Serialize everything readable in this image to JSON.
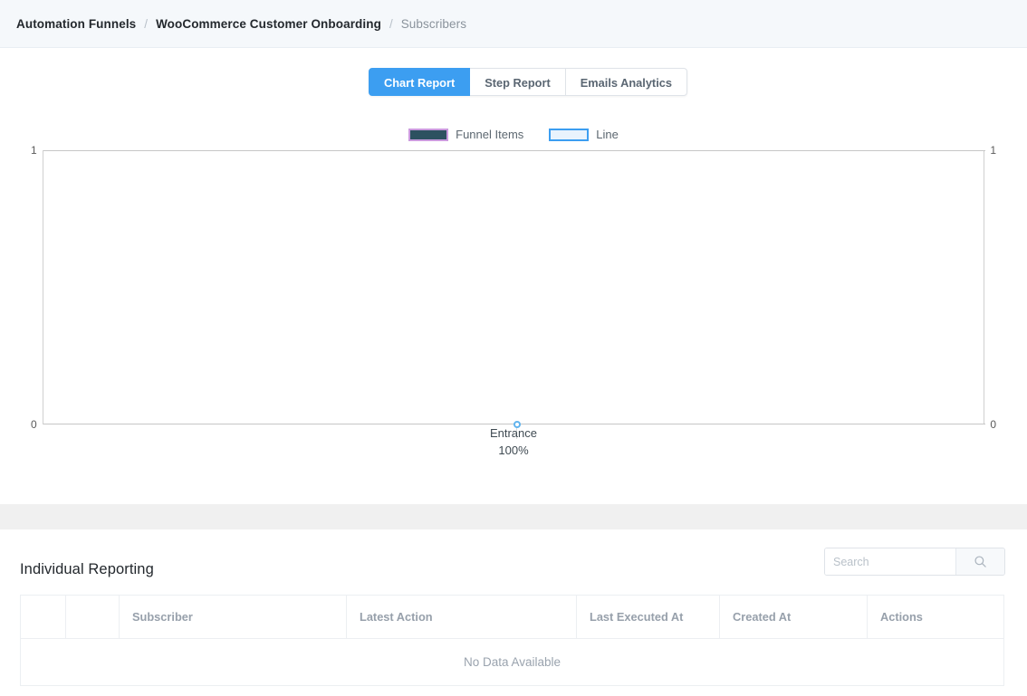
{
  "breadcrumb": {
    "items": [
      {
        "label": "Automation Funnels",
        "muted": false
      },
      {
        "label": "WooCommerce Customer Onboarding",
        "muted": false
      },
      {
        "label": "Subscribers",
        "muted": true
      }
    ],
    "separator": "/"
  },
  "tabs": [
    {
      "label": "Chart Report",
      "active": true
    },
    {
      "label": "Step Report",
      "active": false
    },
    {
      "label": "Emails Analytics",
      "active": false
    }
  ],
  "chart_data": {
    "type": "line",
    "title": "",
    "xlabel": "",
    "ylabel": "",
    "categories": [
      "Entrance"
    ],
    "point_labels": [
      "100%"
    ],
    "series": [
      {
        "name": "Funnel Items",
        "values": [
          0
        ],
        "color": "#2d5160",
        "border_color": "#cb9ade"
      },
      {
        "name": "Line",
        "values": [
          0
        ],
        "color": "#e9f3fd",
        "border_color": "#3c9ef1"
      }
    ],
    "left_axis": {
      "ticks": [
        "1",
        "0"
      ],
      "ylim": [
        0,
        1
      ]
    },
    "right_axis": {
      "ticks": [
        "1",
        "0"
      ],
      "ylim": [
        0,
        1
      ]
    },
    "grid": false,
    "legend_position": "top-center"
  },
  "report": {
    "title": "Individual Reporting",
    "search": {
      "placeholder": "Search",
      "value": "",
      "icon": "search-icon"
    },
    "table": {
      "columns": [
        "",
        "",
        "Subscriber",
        "Latest Action",
        "Last Executed At",
        "Created At",
        "Actions"
      ],
      "rows": [],
      "empty_message": "No Data Available"
    }
  },
  "colors": {
    "accent": "#3c9ef1",
    "header_bg": "#f5f8fb",
    "gap_bg": "#f0f0f0",
    "text_dark": "#23282d",
    "text_muted": "#8a939c"
  }
}
